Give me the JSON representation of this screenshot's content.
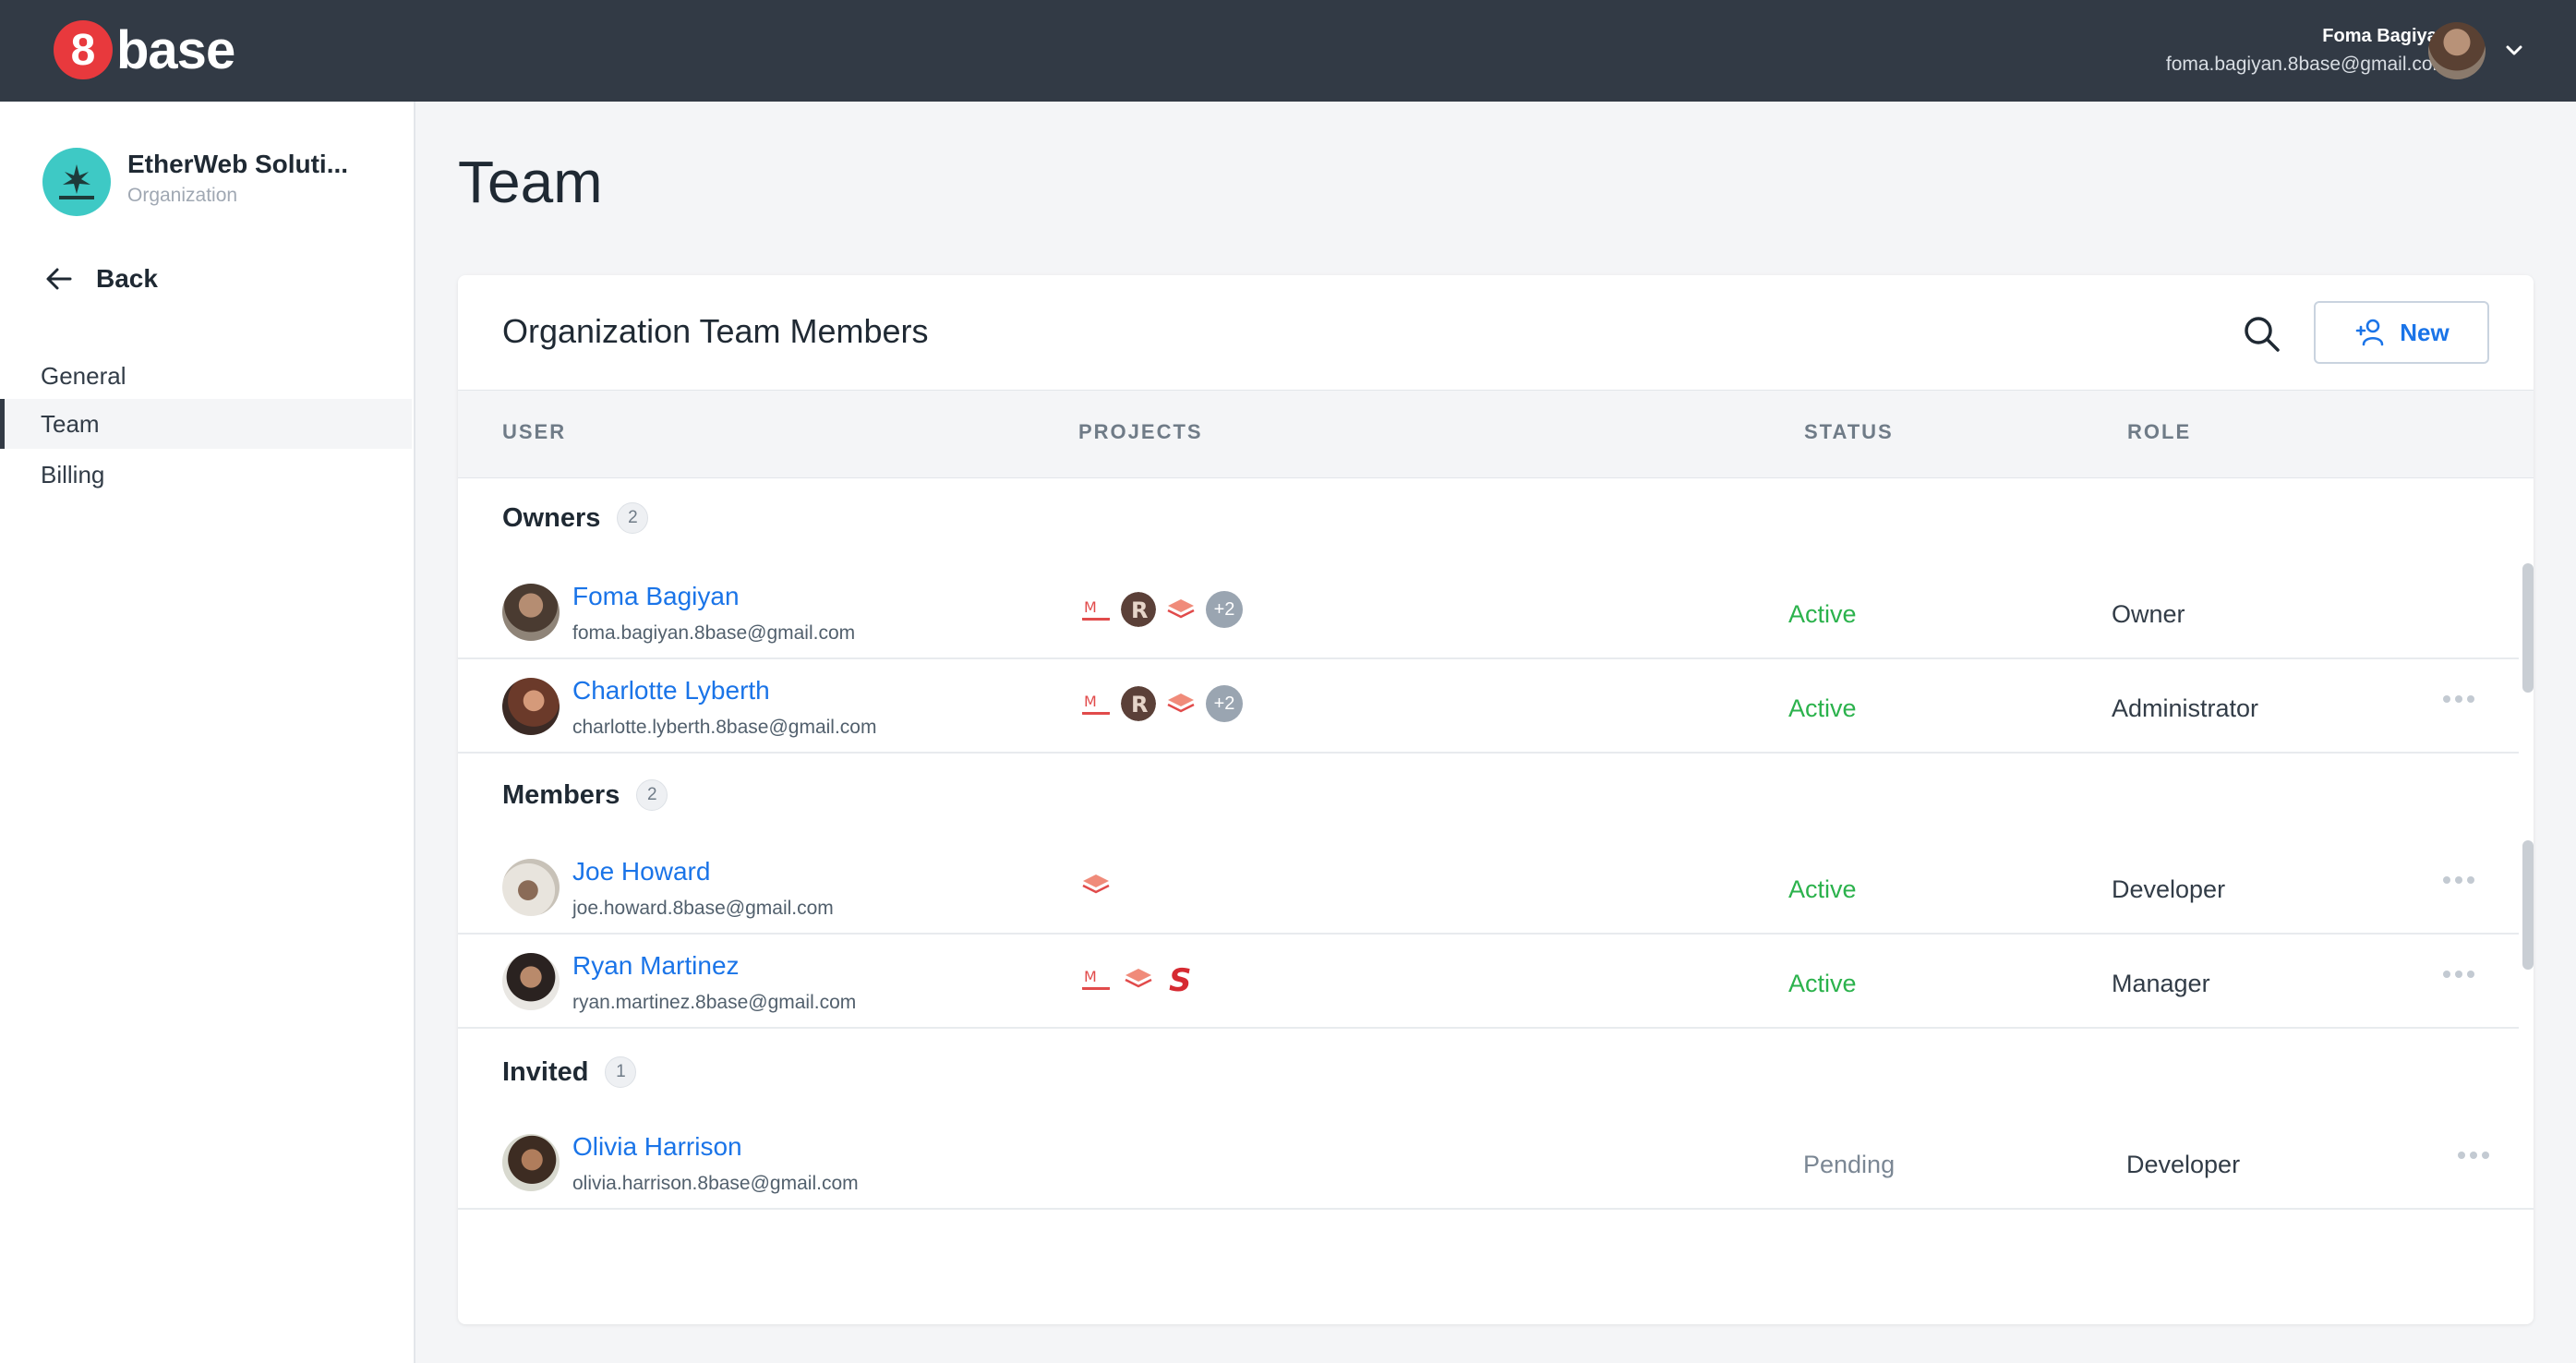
{
  "app": {
    "logo_digit": "8",
    "logo_word": "base",
    "user_name": "Foma Bagiyan",
    "user_email": "foma.bagiyan.8base@gmail.com"
  },
  "sidebar": {
    "org_name": "EtherWeb Soluti...",
    "org_type": "Organization",
    "back_label": "Back",
    "items": [
      {
        "label": "General"
      },
      {
        "label": "Team",
        "active": true
      },
      {
        "label": "Billing"
      }
    ]
  },
  "page": {
    "title": "Team",
    "card_title": "Organization Team Members",
    "new_label": "New",
    "columns": {
      "user": "USER",
      "projects": "PROJECTS",
      "status": "STATUS",
      "role": "ROLE"
    }
  },
  "groups": [
    {
      "name": "Owners",
      "count": "2",
      "members": [
        {
          "name": "Foma Bagiyan",
          "email": "foma.bagiyan.8base@gmail.com",
          "status": "Active",
          "role": "Owner",
          "more_projects": "+2"
        },
        {
          "name": "Charlotte Lyberth",
          "email": "charlotte.lyberth.8base@gmail.com",
          "status": "Active",
          "role": "Administrator",
          "more_projects": "+2"
        }
      ]
    },
    {
      "name": "Members",
      "count": "2",
      "members": [
        {
          "name": "Joe Howard",
          "email": "joe.howard.8base@gmail.com",
          "status": "Active",
          "role": "Developer"
        },
        {
          "name": "Ryan Martinez",
          "email": "ryan.martinez.8base@gmail.com",
          "status": "Active",
          "role": "Manager"
        }
      ]
    },
    {
      "name": "Invited",
      "count": "1",
      "members": [
        {
          "name": "Olivia Harrison",
          "email": "olivia.harrison.8base@gmail.com",
          "status": "Pending",
          "role": "Developer"
        }
      ]
    }
  ],
  "colors": {
    "topbar": "#323a45",
    "accent": "#1a74e8",
    "active": "#2bb24c",
    "pending": "#7b8794",
    "logo": "#e8393d"
  }
}
